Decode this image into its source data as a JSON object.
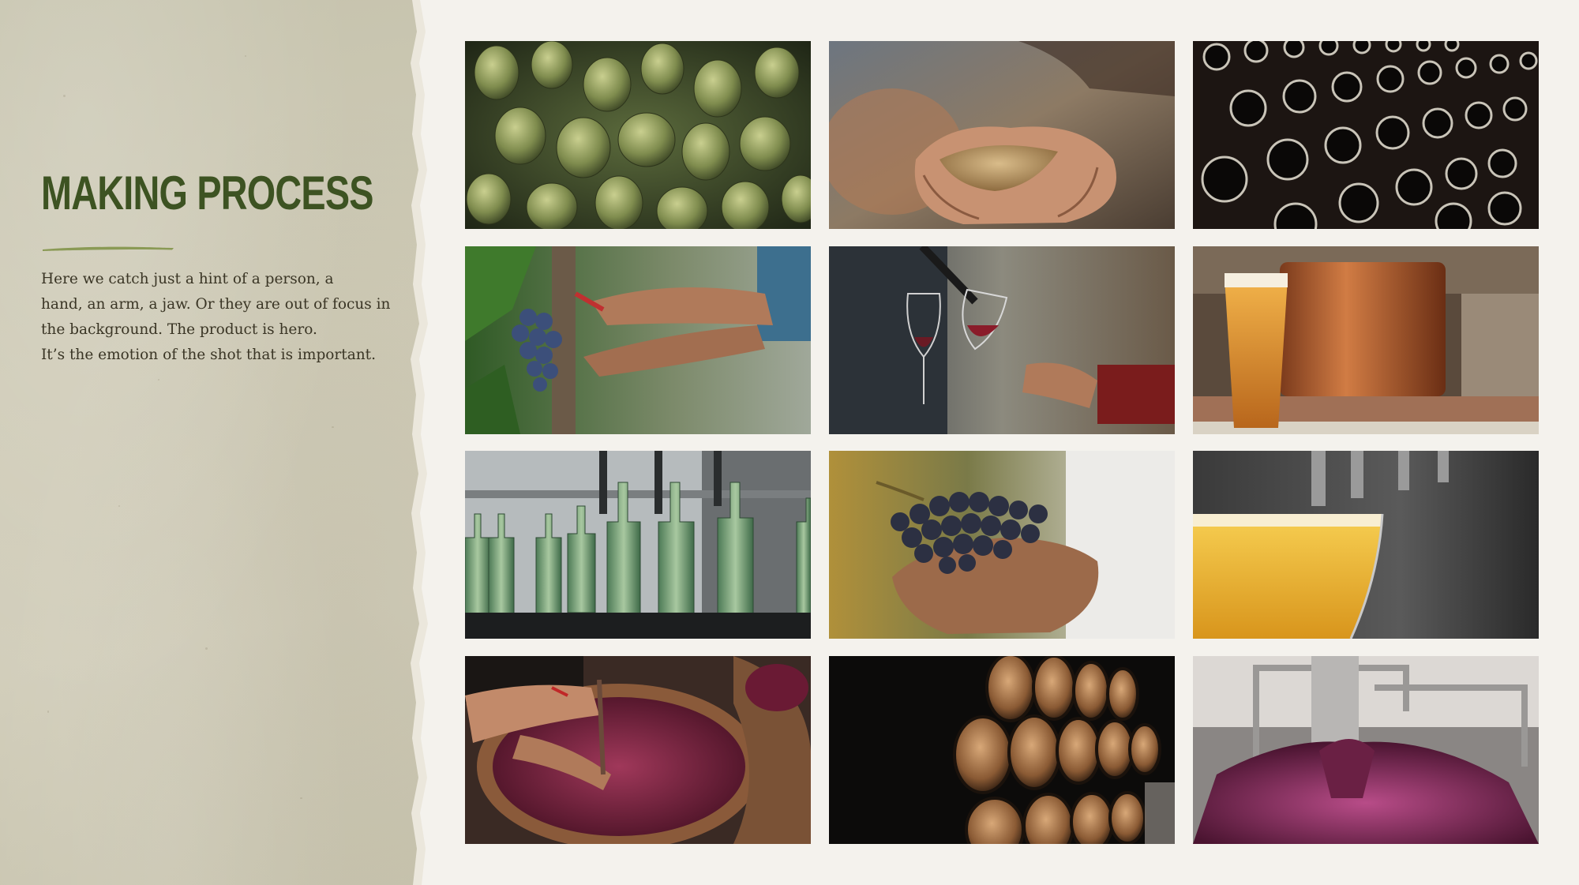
{
  "heading": {
    "title": "MAKING PROCESS"
  },
  "description": {
    "lines": [
      "Here we catch just a hint of a person, a",
      "hand, an arm, a jaw. Or they are out of focus in",
      "the background. The product is hero.",
      "It’s the emotion of the shot that is important."
    ]
  },
  "colors": {
    "title_green": "#3d5322",
    "accent_stroke": "#8a9a55",
    "body_text": "#3a3525",
    "panel": "#cfcbb7",
    "background": "#f4f2ed"
  },
  "photos": [
    {
      "subject": "hop cones"
    },
    {
      "subject": "hands holding grain"
    },
    {
      "subject": "wine bottles in riddling rack"
    },
    {
      "subject": "hands cutting grapes from vine"
    },
    {
      "subject": "red wine poured into glass"
    },
    {
      "subject": "glass of beer in front of copper brew kettle"
    },
    {
      "subject": "green glass bottles on bottling line"
    },
    {
      "subject": "hands holding bunch of grapes"
    },
    {
      "subject": "beer poured from tap into glass"
    },
    {
      "subject": "punching down grapes in wooden barrel"
    },
    {
      "subject": "stacked oak barrels in dark cellar"
    },
    {
      "subject": "grape must spilling from press"
    }
  ]
}
